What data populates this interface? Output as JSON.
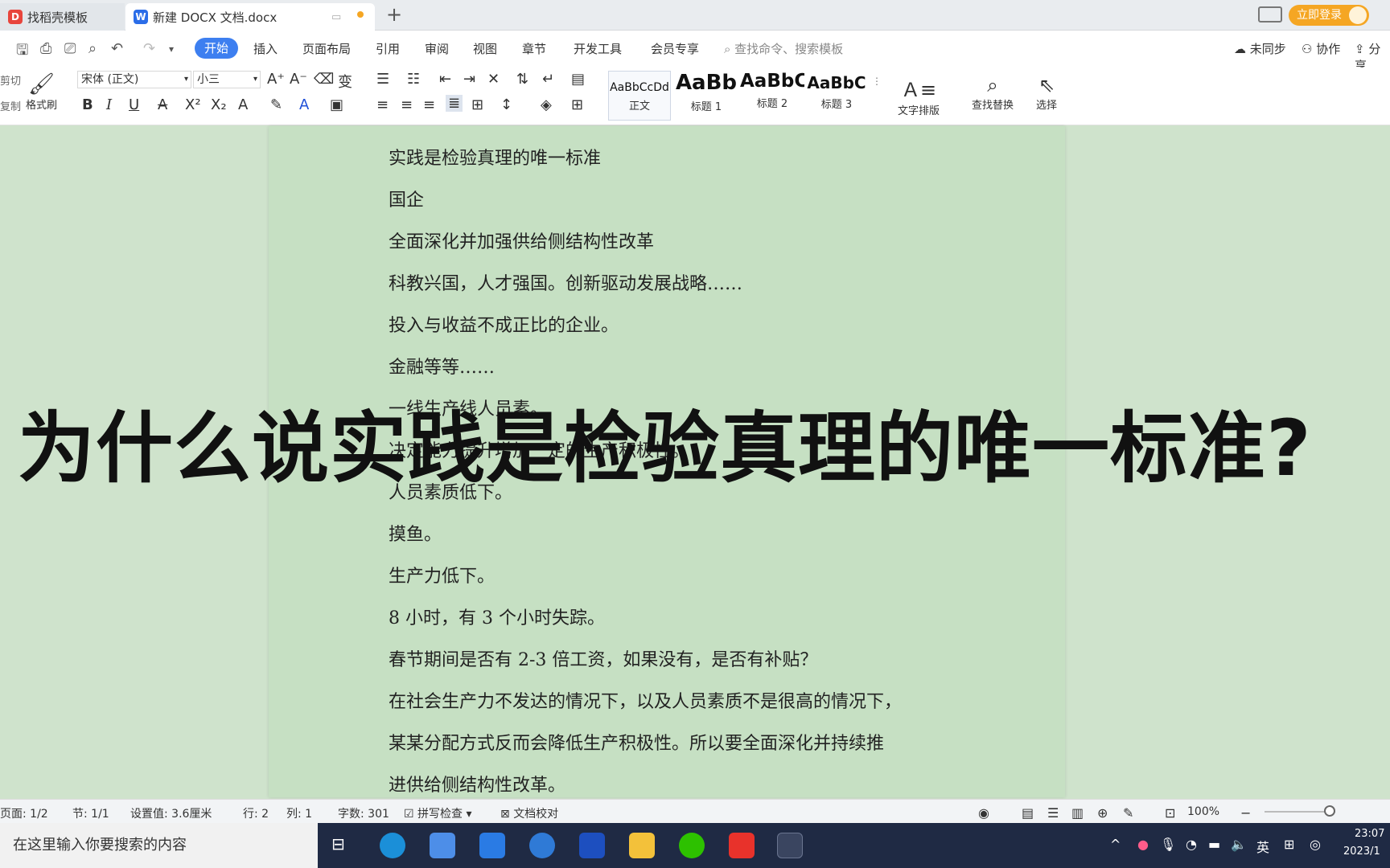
{
  "tabs": [
    {
      "label": "找稻壳模板"
    },
    {
      "label": "新建 DOCX 文档.docx"
    }
  ],
  "login": "立即登录",
  "menu": [
    "开始",
    "插入",
    "页面布局",
    "引用",
    "审阅",
    "视图",
    "章节",
    "开发工具",
    "会员专享"
  ],
  "search_placeholder": "查找命令、搜索模板",
  "sync": [
    "未同步",
    "协作",
    "分享"
  ],
  "ribbon": {
    "cut": "剪切",
    "copy": "复制",
    "format_painter": "格式刷",
    "font": "宋体 (正文)",
    "size": "小三",
    "styles": [
      {
        "preview": "AaBbCcDd",
        "label": "正文"
      },
      {
        "preview": "AaBb",
        "label": "标题 1"
      },
      {
        "preview": "AaBbC",
        "label": "标题 2"
      },
      {
        "preview": "AaBbC",
        "label": "标题 3"
      }
    ],
    "text_layout": "文字排版",
    "find_replace": "查找替换",
    "select": "选择"
  },
  "document": {
    "lines": [
      "实践是检验真理的唯一标准",
      "国企",
      "全面深化并加强供给侧结构性改革",
      "科教兴国，人才强国。创新驱动发展战略……",
      "投入与收益不成正比的企业。",
      "金融等等……",
      "一线生产线人员素。",
      "决定能力提升增加一定的生产积极性。",
      "人员素质低下。",
      "摸鱼。",
      "生产力低下。",
      "8 小时，有 3 个小时失踪。",
      "春节期间是否有 2-3 倍工资，如果没有，是否有补贴？",
      "在社会生产力不发达的情况下，以及人员素质不是很高的情况下，",
      "某某分配方式反而会降低生产积极性。所以要全面深化并持续推",
      "进供给侧结构性改革。"
    ]
  },
  "overlay_title": "为什么说实践是检验真理的唯一标准?",
  "status": {
    "page": "页面: 1/2",
    "section": "节: 1/1",
    "position": "设置值: 3.6厘米",
    "row": "行: 2",
    "col": "列: 1",
    "words": "字数: 301",
    "spell": "拼写检查",
    "proof": "文档校对",
    "zoom": "100%"
  },
  "taskbar": {
    "search": "在这里输入你要搜索的内容",
    "lang": "英",
    "time": "23:07",
    "date": "2023/1"
  }
}
